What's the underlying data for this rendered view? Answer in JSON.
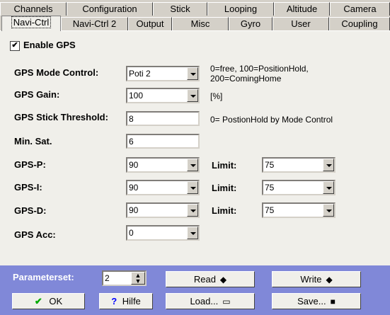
{
  "tabs_row1": [
    "Channels",
    "Configuration",
    "Stick",
    "Looping",
    "Altitude",
    "Camera"
  ],
  "tabs_row2": [
    "Navi-Ctrl",
    "Navi-Ctrl 2",
    "Output",
    "Misc",
    "Gyro",
    "User",
    "Coupling"
  ],
  "enable_gps": {
    "label": "Enable GPS",
    "checked": true,
    "mark": "✔"
  },
  "gps_mode": {
    "label": "GPS Mode Control:",
    "value": "Poti 2",
    "note1": "0=free, 100=PositionHold,",
    "note2": "200=ComingHome"
  },
  "gps_gain": {
    "label": "GPS Gain:",
    "value": "100",
    "note": "[%]"
  },
  "gps_stick": {
    "label": "GPS Stick Threshold:",
    "value": "8",
    "note": "0= PostionHold by Mode Control"
  },
  "min_sat": {
    "label": "Min. Sat.",
    "value": "6"
  },
  "gps_p": {
    "label": "GPS-P:",
    "value": "90",
    "limit_label": "Limit:",
    "limit": "75"
  },
  "gps_i": {
    "label": "GPS-I:",
    "value": "90",
    "limit_label": "Limit:",
    "limit": "75"
  },
  "gps_d": {
    "label": "GPS-D:",
    "value": "90",
    "limit_label": "Limit:",
    "limit": "75"
  },
  "gps_acc": {
    "label": "GPS Acc:",
    "value": "0"
  },
  "bottom": {
    "paramset_label": "Parameterset:",
    "paramset_value": "2",
    "read": "Read",
    "write": "Write",
    "ok": "OK",
    "hilfe": "Hilfe",
    "load": "Load...",
    "save": "Save..."
  }
}
